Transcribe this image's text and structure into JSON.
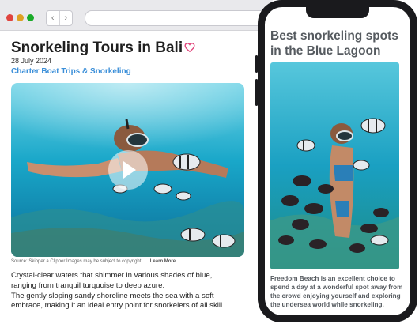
{
  "article": {
    "title": "Snorkeling Tours in Bali",
    "date": "28 July 2024",
    "category": "Charter Boat Trips & Snorkeling",
    "caption_source": "Source: Skipper a Clipper Images may be subject to copyright.",
    "caption_learn_more": "Learn More",
    "body_lines": [
      "Crystal-clear waters that shimmer in various shades of blue,",
      "ranging from tranquil turquoise to deep azure.",
      "The gently sloping sandy shoreline meets the sea with a soft",
      "embrace, making it an ideal entry point for snorkelers of all skill"
    ]
  },
  "mobile": {
    "title": "Best snorkeling spots in the Blue Lagoon",
    "body_lines": [
      "Freedom Beach is an excellent choice to",
      "spend a day at a wonderful spot away from",
      "the crowd enjoying yourself and exploring",
      "the undersea world while snorkeling."
    ]
  },
  "icons": {
    "heart": "heart-icon",
    "play": "play-icon",
    "back": "chevron-left-icon",
    "forward": "chevron-right-icon"
  },
  "colors": {
    "accent": "#3b8fd9",
    "heart": "#e0457b",
    "water": "#1aa3c4"
  }
}
